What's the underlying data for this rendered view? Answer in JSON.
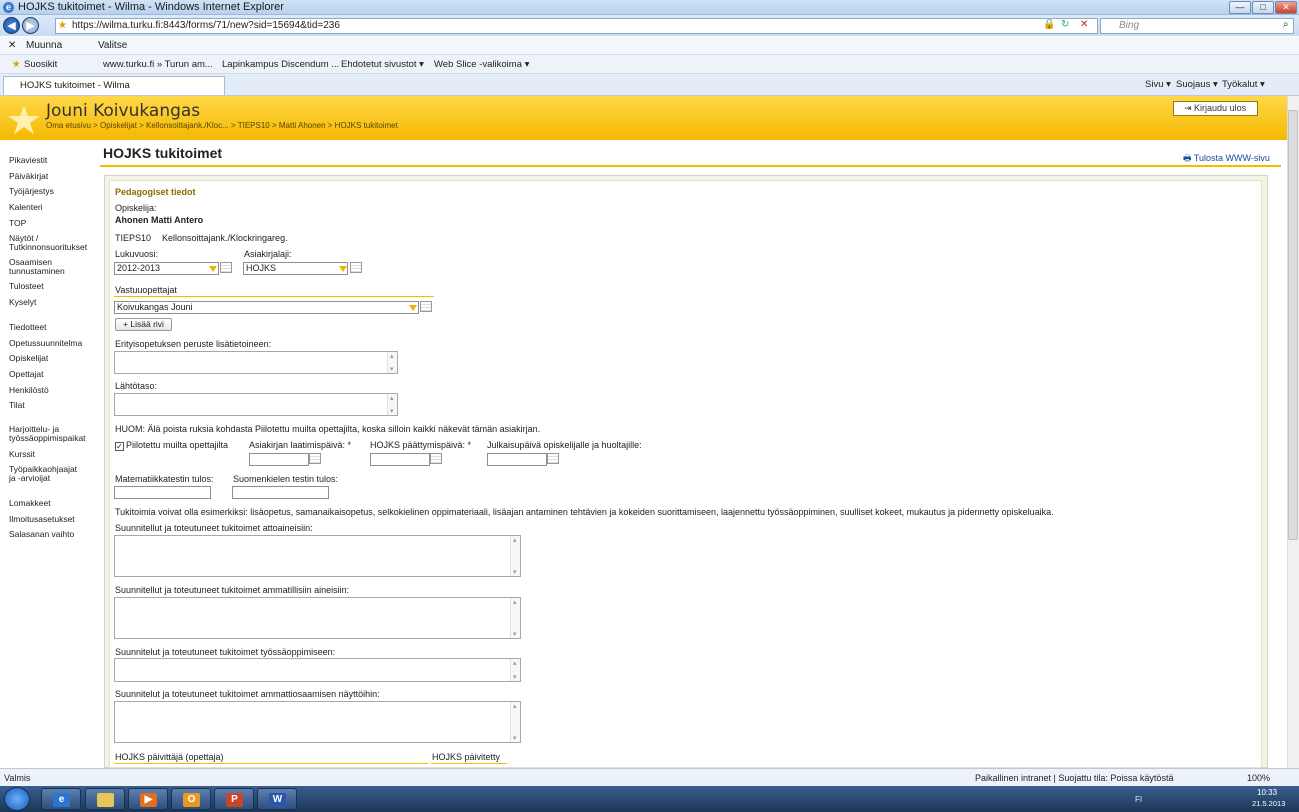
{
  "window": {
    "title": "HOJKS tukitoimet - Wilma - Windows Internet Explorer",
    "min": "—",
    "max": "□",
    "close": "✕"
  },
  "browser": {
    "url": "https://wilma.turku.fi:8443/forms/71/new?sid=15694&tid=236",
    "search_placeholder": "Bing",
    "menu": {
      "close_x": "✕",
      "muunna": "Muunna",
      "valitse": "Valitse"
    },
    "favorites": {
      "suosikit": "Suosikit",
      "f1": "www.turku.fi » Turun am...",
      "f2": "Lapinkampus Discendum ...",
      "f3": "Ehdotetut sivustot ▾",
      "f4": "Web Slice -valikoima ▾"
    },
    "tab_title": "HOJKS tukitoimet - Wilma",
    "tools": {
      "sivu": "Sivu ▾",
      "suojaus": "Suojaus ▾",
      "tyokalut": "Työkalut ▾"
    }
  },
  "header": {
    "user_name": "Jouni Koivukangas",
    "breadcrumb": "Oma etusivu > Opiskelijat > Kellonsoittajank./Kloc... > TIEPS10 > Matti Ahonen > HOJKS tukitoimet",
    "logout": "Kirjaudu ulos"
  },
  "sidebar": {
    "items": [
      "Pikaviestit",
      "Päiväkirjat",
      "Työjärjestys",
      "Kalenteri",
      "TOP",
      "Näytöt /",
      "Tutkinnonsuoritukset",
      "Osaamisen",
      "tunnustaminen",
      "Tulosteet",
      "Kyselyt",
      "Tiedotteet",
      "Opetussuunnitelma",
      "Opiskelijat",
      "Opettajat",
      "Henkilöstö",
      "Tilat",
      "Harjoittelu- ja",
      "työssäoppimispaikat",
      "Kurssit",
      "Työpaikkaohjaajat",
      "ja -arvioijat",
      "Lomakkeet",
      "Ilmoitusasetukset",
      "Salasanan vaihto"
    ]
  },
  "page": {
    "title": "HOJKS tukitoimet",
    "print": "Tulosta WWW-sivu"
  },
  "form": {
    "section": "Pedagogiset tiedot",
    "student_label": "Opiskelija:",
    "student_name": "Ahonen Matti Antero",
    "group": "TIEPS10",
    "group_name": "Kellonsoittajank./Klockringareg.",
    "lukuvuosi_label": "Lukuvuosi:",
    "lukuvuosi_value": "2012-2013",
    "asiakirjalaji_label": "Asiakirjalaji:",
    "asiakirjalaji_value": "HOJKS",
    "vastuuopettajat_label": "Vastuuopettajat",
    "vastuuopettaja_value": "Koivukangas Jouni",
    "add_row": "+ Lisää rivi",
    "erityis_label": "Erityisopetuksen peruste lisätietoineen:",
    "lahtotaso_label": "Lähtötaso:",
    "huom": "HUOM: Älä poista ruksia kohdasta Piilotettu muilta opettajilta, koska silloin kaikki näkevät tämän asiakirjan.",
    "hidden_label": "Piilotettu muilta opettajilta",
    "hidden_checked": true,
    "laatimis_label": "Asiakirjan laatimispäivä: *",
    "paattymis_label": "HOJKS päättymispäivä: *",
    "julkaisu_label": "Julkaisupäivä opiskelijalle ja huoltajille:",
    "mat_label": "Matematiikkatestin tulos:",
    "suomi_label": "Suomenkielen testin tulos:",
    "tukitoimia": "Tukitoimia voivat olla esimerkiksi: lisäopetus, samanaikaisopetus, selkokielinen oppimateriaali, lisäajan antaminen tehtävien ja kokeiden suorittamiseen, laajennettu työssäoppiminen, suulliset kokeet, mukautus ja pidennetty opiskeluaika.",
    "yhteiset_label": "Suunnitellut ja toteutuneet tukitoimet attoaineisiin:",
    "ammatilliset_label": "Suunnitellut ja toteutuneet tukitoimet ammatillisiin aineisiin:",
    "tyossa_label": "Suunnitelut ja toteutuneet tukitoimet työssäoppimiseen:",
    "naytot_label": "Suunnitelut ja toteutuneet tukitoimet ammattiosaamisen näyttöihin:",
    "paivittaja_label": "HOJKS päivittäjä (opettaja)",
    "paivitetty_label": "HOJKS päivitetty"
  },
  "status": {
    "left": "Valmis",
    "zone": "Paikallinen intranet | Suojattu tila: Poissa käytöstä",
    "zoom": "100%"
  },
  "taskbar": {
    "lang": "FI",
    "time": "10:33",
    "date": "21.5.2013"
  },
  "colors": {
    "accent": "#f5b800",
    "section": "#8a6d00",
    "link": "#1a4d99"
  }
}
